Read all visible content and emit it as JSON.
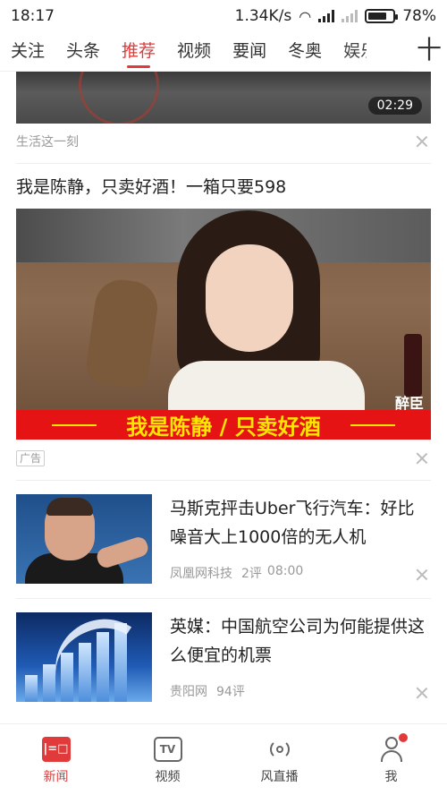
{
  "status_bar": {
    "time": "18:17",
    "speed": "1.34K/s",
    "battery": "78%",
    "battery_level": 0.78
  },
  "tabs": [
    {
      "label": "关注",
      "active": false
    },
    {
      "label": "头条",
      "active": false
    },
    {
      "label": "推荐",
      "active": true
    },
    {
      "label": "视频",
      "active": false
    },
    {
      "label": "要闻",
      "active": false
    },
    {
      "label": "冬奥",
      "active": false
    },
    {
      "label": "娱乐",
      "active": false
    }
  ],
  "add_tab_label": "十",
  "feed": {
    "video": {
      "duration": "02:29",
      "source": "生活这一刻"
    },
    "ad": {
      "title": "我是陈静，只卖好酒！一箱只要598",
      "banner": "我是陈静 / 只卖好酒",
      "brand": "醉臣",
      "tag": "广告"
    },
    "news": [
      {
        "title": "马斯克抨击Uber飞行汽车：好比噪音大上1000倍的无人机",
        "source": "凤凰网科技",
        "comments": "2评",
        "time": "08:00"
      },
      {
        "title": "英媒：中国航空公司为何能提供这么便宜的机票",
        "source": "贵阳网",
        "comments": "94评",
        "time": ""
      }
    ]
  },
  "bottom_nav": [
    {
      "label": "新闻",
      "icon": "news-icon",
      "active": true
    },
    {
      "label": "视频",
      "icon": "tv-icon",
      "active": false
    },
    {
      "label": "风直播",
      "icon": "live-icon",
      "active": false
    },
    {
      "label": "我",
      "icon": "profile-icon",
      "active": false
    }
  ],
  "colors": {
    "accent": "#e03a3a",
    "ad_banner": "#e51313",
    "ad_banner_text": "#ffe600"
  }
}
